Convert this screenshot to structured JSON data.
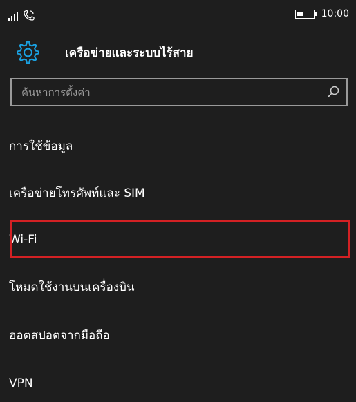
{
  "status_bar": {
    "time": "10:00",
    "signal_icon": "cellular-signal-icon",
    "wifi_calling_icon": "wifi-calling-icon",
    "battery_icon": "battery-icon"
  },
  "header": {
    "icon": "gear-icon",
    "title": "เครือข่ายและระบบไร้สาย"
  },
  "search": {
    "placeholder": "ค้นหาการตั้งค่า",
    "value": "",
    "icon": "search-icon"
  },
  "settings_list": {
    "items": [
      {
        "label": "การใช้ข้อมูล"
      },
      {
        "label": "เครือข่ายโทรศัพท์และ SIM"
      },
      {
        "label": "Wi-Fi"
      },
      {
        "label": "โหมดใช้งานบนเครื่องบิน"
      },
      {
        "label": "ฮอตสปอตจากมือถือ"
      },
      {
        "label": "VPN"
      }
    ]
  },
  "colors": {
    "background": "#1e1e1e",
    "accent": "#1aa0e0",
    "highlight": "#d32124",
    "border": "#9a9a9a"
  }
}
